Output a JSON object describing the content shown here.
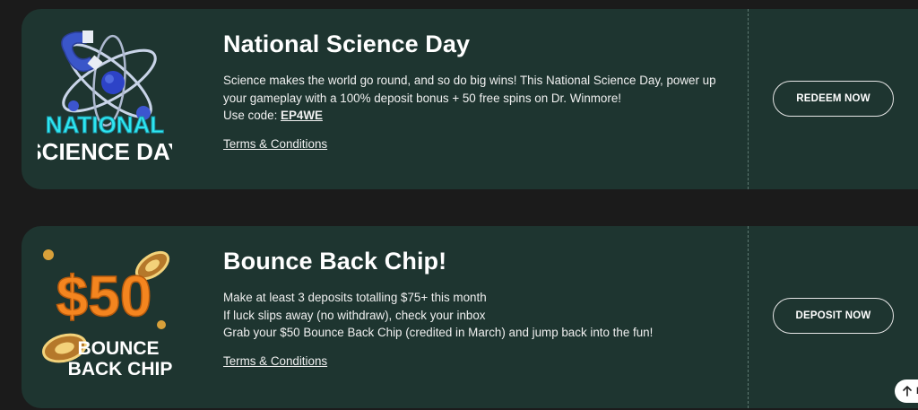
{
  "promos": [
    {
      "title": "National Science Day",
      "description_line1": "Science makes the world go round, and so do big wins! This National Science Day, power up",
      "description_line2": "your gameplay with a 100% deposit bonus + 50 free spins on Dr. Winmore!",
      "code_prefix": "Use code: ",
      "code": "EP4WE",
      "terms_label": "Terms & Conditions",
      "cta_label": "REDEEM NOW",
      "art_line1": "NATIONAL",
      "art_line2": "SCIENCE DAY",
      "art_icon": "atom-magnet-icon"
    },
    {
      "title": "Bounce Back Chip!",
      "description_line1": "Make at least 3 deposits totalling $75+ this month",
      "description_line2": "If luck slips away (no withdraw), check your inbox",
      "description_line3": "Grab your $50 Bounce Back Chip (credited in March) and jump back into the fun!",
      "terms_label": "Terms & Conditions",
      "cta_label": "DEPOSIT NOW",
      "art_amount": "$50",
      "art_line1": "BOUNCE",
      "art_line2": "BACK CHIP",
      "art_icon": "casino-chip-icon"
    }
  ],
  "fab": {
    "icon": "arrow-up-icon",
    "label": "B"
  },
  "colors": {
    "page_bg": "#1b1b1b",
    "card_bg": "#1e3530",
    "cyan": "#2ee6f0",
    "orange": "#f4851f",
    "gold": "#d8a03a"
  }
}
